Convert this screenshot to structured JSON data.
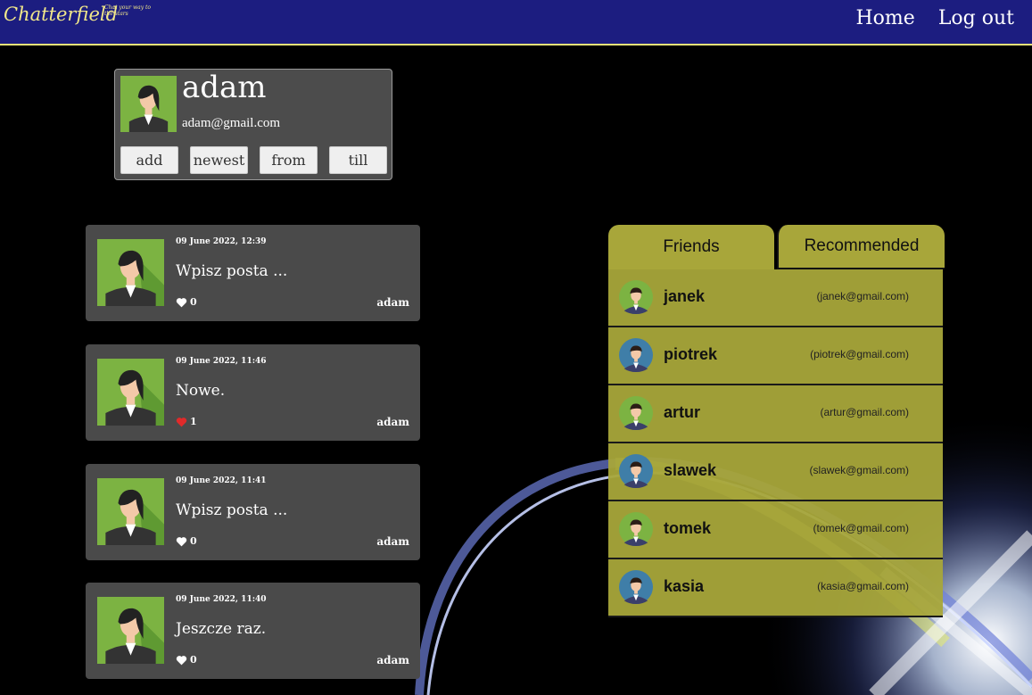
{
  "app": {
    "brand": "Chatterfield",
    "tagline": "Chat your way to the stars"
  },
  "nav": {
    "home": "Home",
    "logout": "Log out"
  },
  "profile": {
    "name": "adam",
    "email": "adam@gmail.com",
    "buttons": {
      "add": "add",
      "newest": "newest",
      "from": "from",
      "till": "till"
    }
  },
  "posts": [
    {
      "date": "09 June 2022, 12:39",
      "text": "Wpisz posta ...",
      "likes": "0",
      "liked": false,
      "author": "adam"
    },
    {
      "date": "09 June 2022, 11:46",
      "text": "Nowe.",
      "likes": "1",
      "liked": true,
      "author": "adam"
    },
    {
      "date": "09 June 2022, 11:41",
      "text": "Wpisz posta ...",
      "likes": "0",
      "liked": false,
      "author": "adam"
    },
    {
      "date": "09 June 2022, 11:40",
      "text": "Jeszcze raz.",
      "likes": "0",
      "liked": false,
      "author": "adam"
    }
  ],
  "tabs": {
    "friends": "Friends",
    "recommended": "Recommended"
  },
  "friends": [
    {
      "name": "janek",
      "email": "(janek@gmail.com)",
      "avatar": "man-green-avatar-icon"
    },
    {
      "name": "piotrek",
      "email": "(piotrek@gmail.com)",
      "avatar": "man-blue-avatar-icon"
    },
    {
      "name": "artur",
      "email": "(artur@gmail.com)",
      "avatar": "woman-green-avatar-icon"
    },
    {
      "name": "slawek",
      "email": "(slawek@gmail.com)",
      "avatar": "man-blue-avatar-icon"
    },
    {
      "name": "tomek",
      "email": "(tomek@gmail.com)",
      "avatar": "man-green-avatar-icon"
    },
    {
      "name": "kasia",
      "email": "(kasia@gmail.com)",
      "avatar": "man-blue-avatar-icon"
    }
  ],
  "colors": {
    "header": "#1c1d80",
    "brand": "#f1e78a",
    "card": "#4a4a4a",
    "panel": "#a8a63a",
    "liked_heart": "#e02a2a"
  }
}
